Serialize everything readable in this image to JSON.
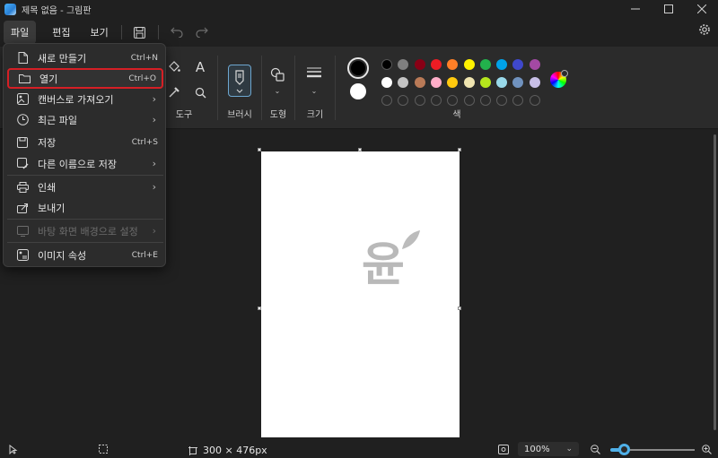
{
  "window": {
    "title": "제목 없음 - 그림판"
  },
  "menubar": {
    "file": "파일",
    "edit": "편집",
    "view": "보기"
  },
  "ribbon": {
    "tools_label": "도구",
    "brush_label": "브러시",
    "shape_label": "도형",
    "size_label": "크기",
    "colors_label": "색",
    "text_tool": "A",
    "primary_color": "#000000",
    "secondary_color": "#ffffff",
    "palette_row1": [
      "#000000",
      "#7f7f7f",
      "#880015",
      "#ed1c24",
      "#ff7f27",
      "#fff200",
      "#22b14c",
      "#00a2e8",
      "#3f48cc",
      "#a349a4"
    ],
    "palette_row2": [
      "#ffffff",
      "#c3c3c3",
      "#b97a57",
      "#ffaec9",
      "#ffc90e",
      "#efe4b0",
      "#b5e61d",
      "#99d9ea",
      "#7092be",
      "#c8bfe7"
    ]
  },
  "file_menu": {
    "items": [
      {
        "label": "새로 만들기",
        "shortcut": "Ctrl+N"
      },
      {
        "label": "열기",
        "shortcut": "Ctrl+O"
      },
      {
        "label": "캔버스로 가져오기",
        "shortcut": ""
      },
      {
        "label": "최근 파일",
        "shortcut": ""
      },
      {
        "label": "저장",
        "shortcut": "Ctrl+S"
      },
      {
        "label": "다른 이름으로 저장",
        "shortcut": ""
      },
      {
        "label": "인쇄",
        "shortcut": ""
      },
      {
        "label": "보내기",
        "shortcut": ""
      },
      {
        "label": "바탕 화면 배경으로 설정",
        "shortcut": ""
      },
      {
        "label": "이미지 속성",
        "shortcut": "Ctrl+E"
      }
    ],
    "highlighted": "열기"
  },
  "canvas": {
    "watermark_text": "윤"
  },
  "status": {
    "canvas_size": "300 × 476px",
    "zoom": "100%",
    "zoom_fraction": 0.16
  }
}
